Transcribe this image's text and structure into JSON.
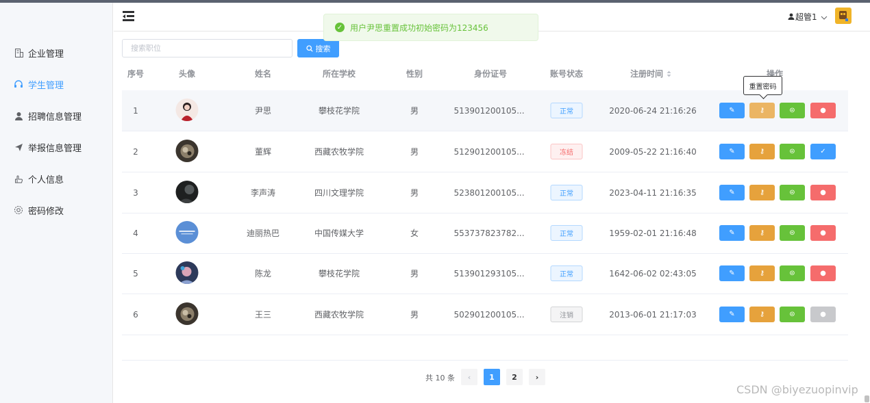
{
  "sidebar": {
    "items": [
      {
        "label": "企业管理",
        "icon": "building-icon"
      },
      {
        "label": "学生管理",
        "icon": "headset-icon",
        "active": true
      },
      {
        "label": "招聘信息管理",
        "icon": "user-icon"
      },
      {
        "label": "举报信息管理",
        "icon": "send-icon"
      },
      {
        "label": "个人信息",
        "icon": "hand-icon"
      },
      {
        "label": "密码修改",
        "icon": "gear-icon"
      }
    ]
  },
  "header": {
    "user_name": "超管1"
  },
  "toast": {
    "message": "用户尹思重置成功初始密码为123456",
    "type": "success"
  },
  "search": {
    "placeholder": "搜索职位",
    "button_label": "搜索"
  },
  "table": {
    "columns": [
      "序号",
      "头像",
      "姓名",
      "所在学校",
      "性别",
      "身份证号",
      "账号状态",
      "注册时间",
      "操作"
    ],
    "rows": [
      {
        "index": "1",
        "name": "尹思",
        "school": "攀枝花学院",
        "gender": "男",
        "id_number": "513901200105...",
        "status": "正常",
        "registered": "2020-06-24 21:16:26"
      },
      {
        "index": "2",
        "name": "董辉",
        "school": "西藏农牧学院",
        "gender": "男",
        "id_number": "512901200105...",
        "status": "冻结",
        "registered": "2009-05-22 21:16:40"
      },
      {
        "index": "3",
        "name": "李声涛",
        "school": "四川文理学院",
        "gender": "男",
        "id_number": "523801200105...",
        "status": "正常",
        "registered": "2023-04-11 21:16:35"
      },
      {
        "index": "4",
        "name": "迪丽热巴",
        "school": "中国传媒大学",
        "gender": "女",
        "id_number": "553737823782...",
        "status": "正常",
        "registered": "1959-02-01 21:16:48"
      },
      {
        "index": "5",
        "name": "陈龙",
        "school": "攀枝花学院",
        "gender": "男",
        "id_number": "513901293105...",
        "status": "正常",
        "registered": "1642-06-02 02:43:05"
      },
      {
        "index": "6",
        "name": "王三",
        "school": "西藏农牧学院",
        "gender": "男",
        "id_number": "502901200105...",
        "status": "注销",
        "registered": "2013-06-01 21:17:03"
      }
    ]
  },
  "tooltip": "重置密码",
  "pagination": {
    "total_text": "共 10 条",
    "pages": [
      "1",
      "2"
    ],
    "current": "1",
    "prev": "‹",
    "next": "›"
  },
  "watermark": "CSDN @biyezuopinvip",
  "colors": {
    "primary": "#409eff",
    "warning": "#e6a23c",
    "success": "#67c23a",
    "danger": "#f56c6c"
  }
}
